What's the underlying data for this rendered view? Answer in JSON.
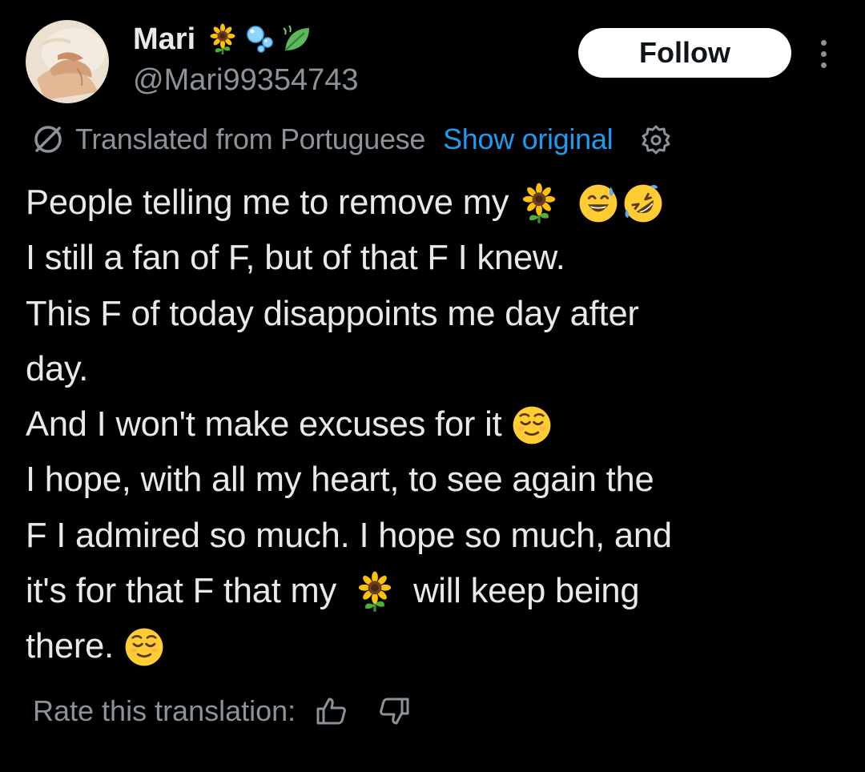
{
  "author": {
    "display_name": "Mari",
    "name_emojis": [
      "sunflower-emoji",
      "bubbles-emoji",
      "leaf-emoji"
    ],
    "handle": "@Mari99354743",
    "avatar": "avatar-hands-photo"
  },
  "follow_label": "Follow",
  "more_icon": "more-vertical-icon",
  "translation": {
    "icon": "translate-globe-icon",
    "label": "Translated from Portuguese",
    "show_original": "Show original",
    "settings_icon": "gear-icon"
  },
  "tweet": {
    "line1": "People telling me to remove my",
    "line2": "I still a fan of F, but of that F I knew.",
    "line3": "This F of today disappoints me day after",
    "line4": "day.",
    "line5": "And I won't make excuses for it",
    "line6": "I hope, with all my heart, to see again the",
    "line7": "F I admired so much. I hope so much, and",
    "line8a": "it's for that F that my",
    "line8b": "will keep being",
    "line9": "there.",
    "emojis": [
      "sunflower-emoji",
      "sweat-smile-emoji",
      "rofl-emoji",
      "relieved-emoji"
    ]
  },
  "rating": {
    "label": "Rate this translation:",
    "up_icon": "thumbs-up-icon",
    "down_icon": "thumbs-down-icon"
  },
  "colors": {
    "background": "#000000",
    "text": "#e7e9ea",
    "secondary": "#8b9299",
    "link": "#1d9bf0",
    "button_bg": "#ffffff"
  }
}
